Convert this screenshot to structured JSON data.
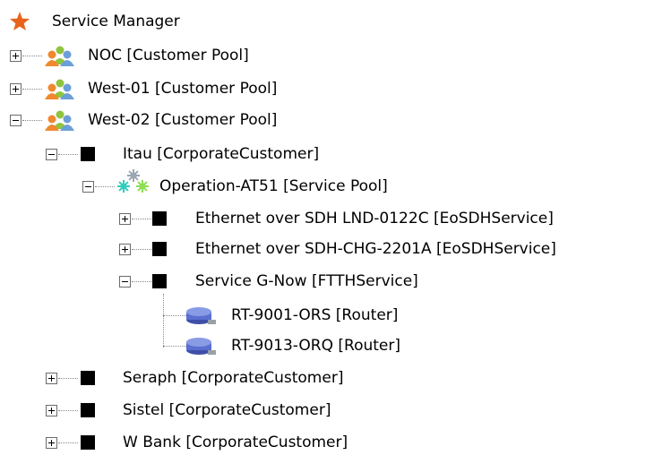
{
  "tree": {
    "root": "Service Manager",
    "nodes": [
      {
        "label": "NOC [Customer Pool]",
        "icon": "customer-pool-icon",
        "state": "collapsed"
      },
      {
        "label": "West-01 [Customer Pool]",
        "icon": "customer-pool-icon",
        "state": "collapsed"
      },
      {
        "label": "West-02 [Customer Pool]",
        "icon": "customer-pool-icon",
        "state": "expanded"
      },
      {
        "label": "Itau [CorporateCustomer]",
        "icon": "corporate-customer-icon",
        "state": "expanded"
      },
      {
        "label": "Operation-AT51 [Service Pool]",
        "icon": "service-pool-icon",
        "state": "expanded"
      },
      {
        "label": "Ethernet over SDH LND-0122C [EoSDHService]",
        "icon": "service-icon",
        "state": "collapsed"
      },
      {
        "label": "Ethernet over SDH-CHG-2201A [EoSDHService]",
        "icon": "service-icon",
        "state": "collapsed"
      },
      {
        "label": "Service G-Now [FTTHService]",
        "icon": "service-icon",
        "state": "expanded"
      },
      {
        "label": "RT-9001-ORS [Router]",
        "icon": "router-icon",
        "state": "leaf"
      },
      {
        "label": "RT-9013-ORQ [Router]",
        "icon": "router-icon",
        "state": "leaf"
      },
      {
        "label": "Seraph [CorporateCustomer]",
        "icon": "corporate-customer-icon",
        "state": "collapsed"
      },
      {
        "label": "Sistel [CorporateCustomer]",
        "icon": "corporate-customer-icon",
        "state": "collapsed"
      },
      {
        "label": "W Bank [CorporateCustomer]",
        "icon": "corporate-customer-icon",
        "state": "collapsed"
      }
    ]
  },
  "colors": {
    "root_star": "#e8641b",
    "person_orange": "#f0892e",
    "person_green": "#8fc43f",
    "person_blue": "#6b9fd8",
    "gear_teal": "#33ccbb",
    "gear_green": "#8fdd55",
    "gear_gray": "#9aa6b2",
    "router_blue": "#5a6fd0"
  }
}
